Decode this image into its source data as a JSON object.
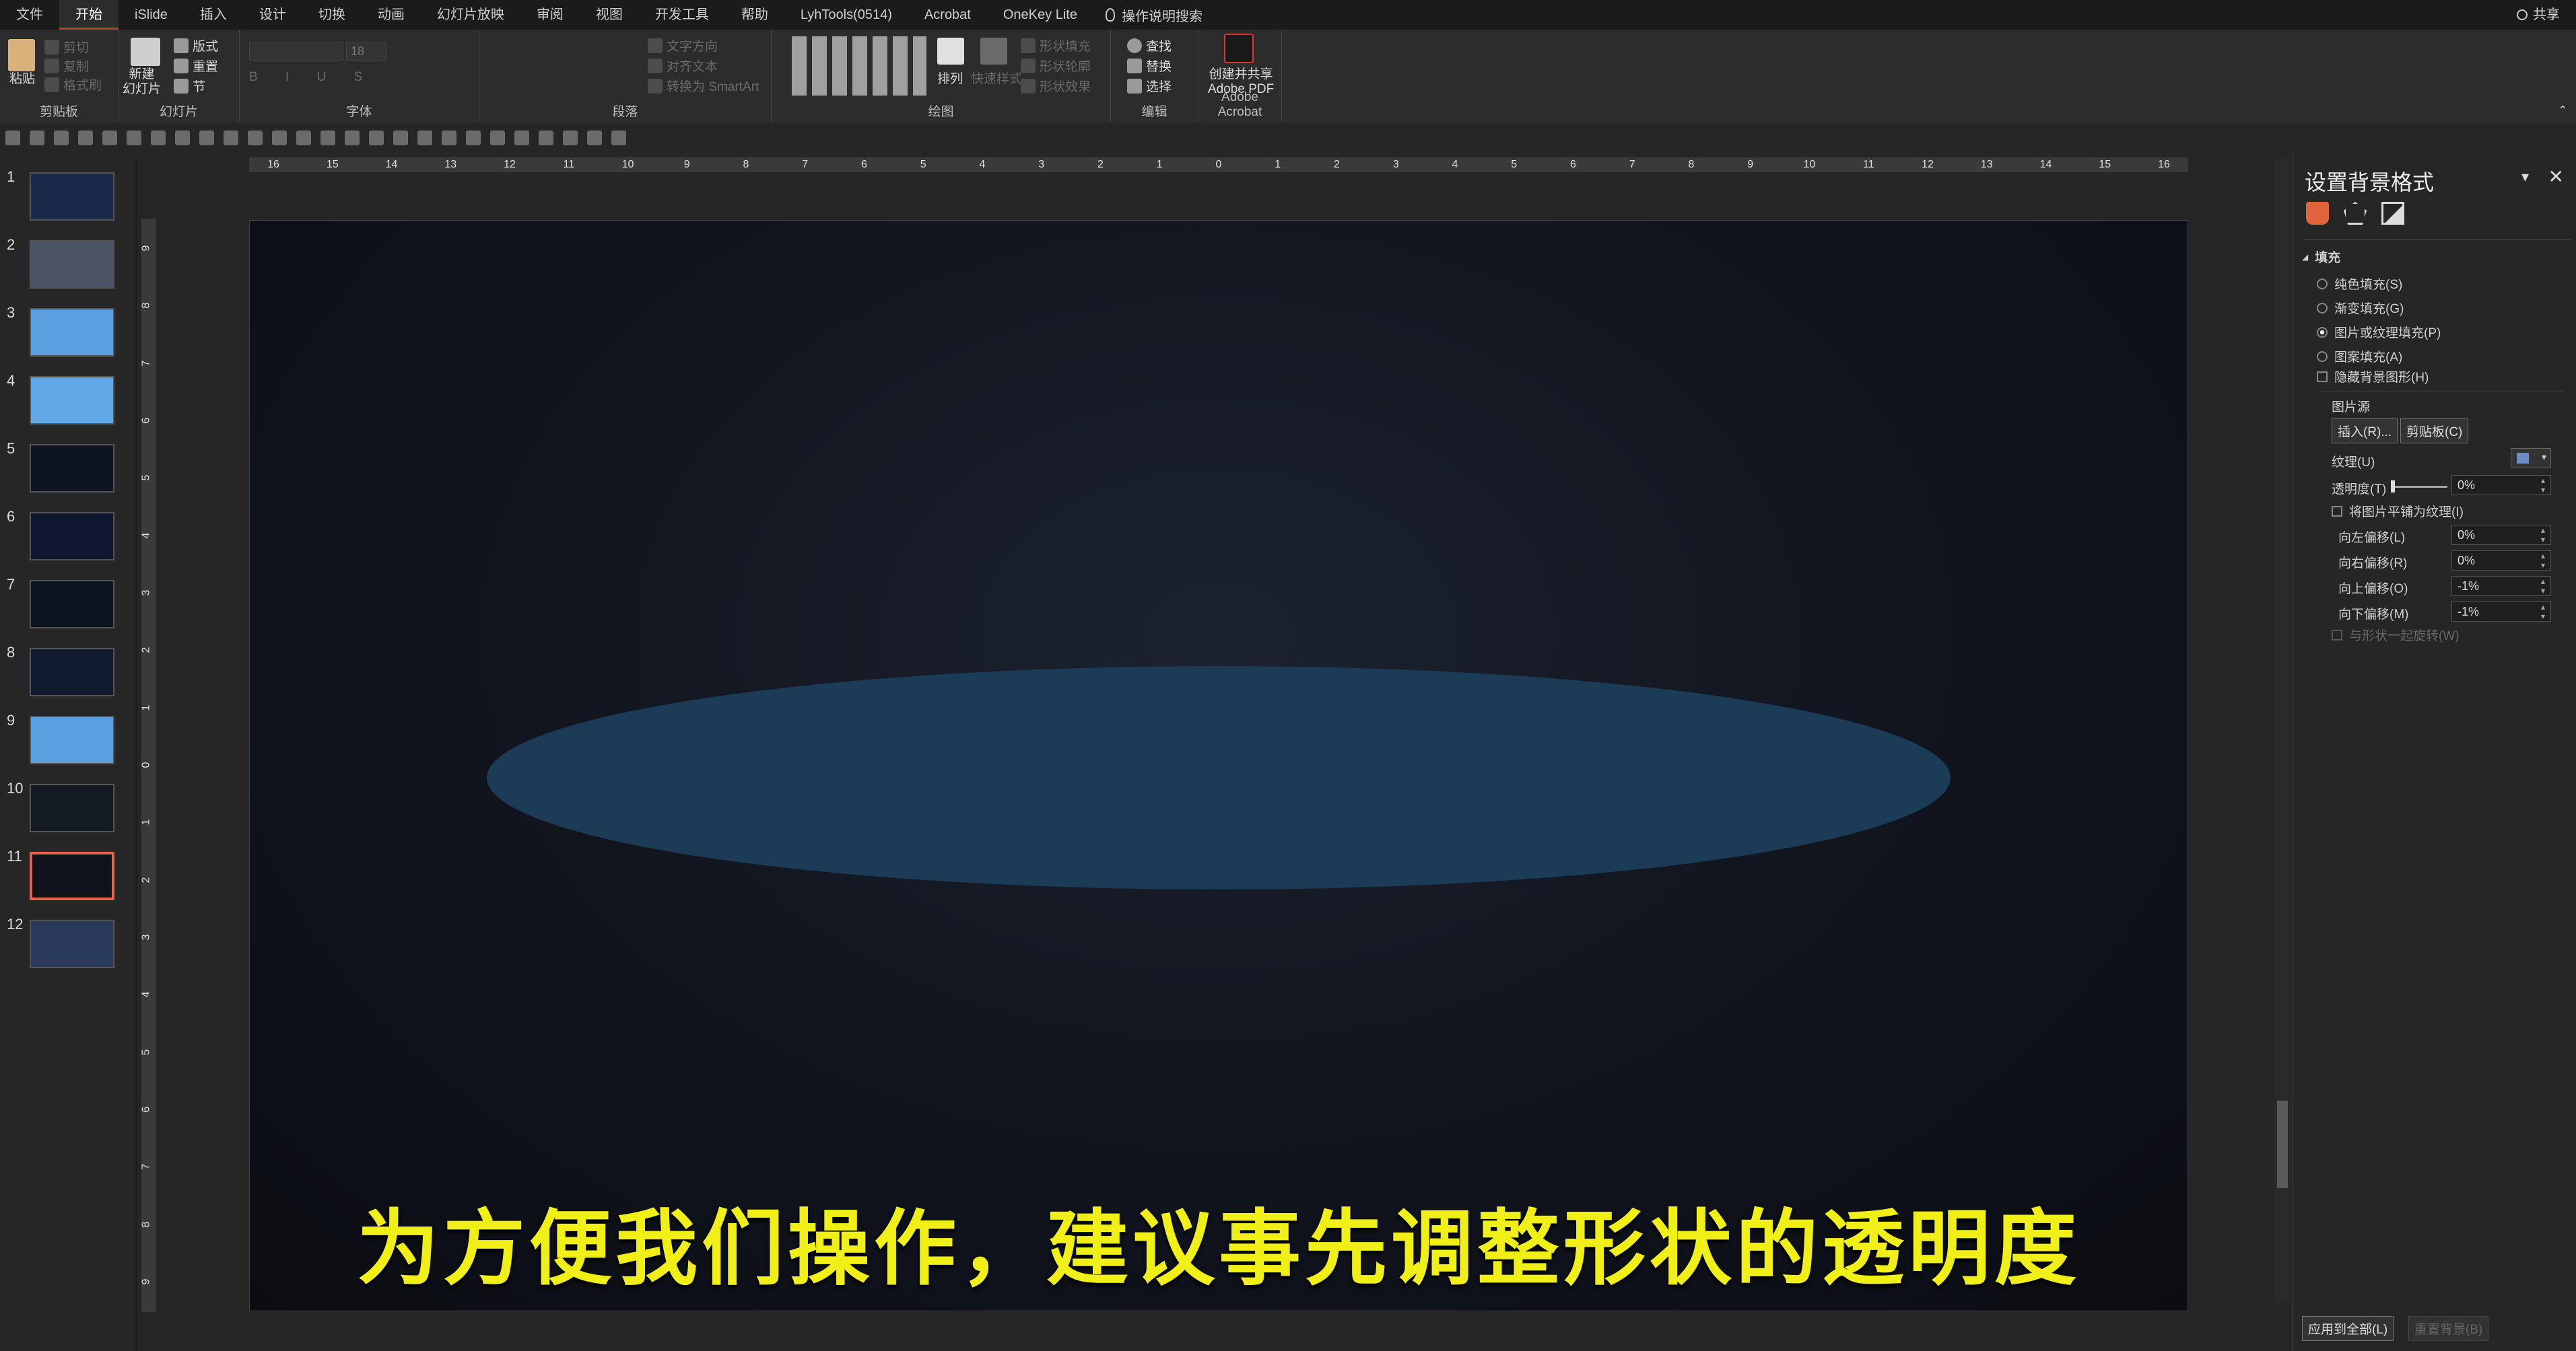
{
  "tabs": [
    "文件",
    "开始",
    "iSlide",
    "插入",
    "设计",
    "切换",
    "动画",
    "幻灯片放映",
    "审阅",
    "视图",
    "开发工具",
    "帮助",
    "LyhTools(0514)",
    "Acrobat",
    "OneKey Lite"
  ],
  "active_tab": "开始",
  "search_label": "操作说明搜索",
  "share_label": "共享",
  "ribbon": {
    "clipboard": {
      "paste": "粘贴",
      "cut": "剪切",
      "copy": "复制",
      "format_painter": "格式刷",
      "label": "剪贴板"
    },
    "slides": {
      "new_slide": "新建\n幻灯片",
      "layout": "版式",
      "reset": "重置",
      "section": "节",
      "label": "幻灯片"
    },
    "font": {
      "size": "18",
      "label": "字体"
    },
    "paragraph": {
      "text_dir": "文字方向",
      "align_text": "对齐文本",
      "smartart": "转换为 SmartArt",
      "label": "段落"
    },
    "drawing": {
      "arrange": "排列",
      "quick_styles": "快速样式",
      "shape_fill": "形状填充",
      "shape_outline": "形状轮廓",
      "shape_effects": "形状效果",
      "label": "绘图"
    },
    "editing": {
      "find": "查找",
      "replace": "替换",
      "select": "选择",
      "label": "编辑"
    },
    "acrobat": {
      "create": "创建并共享\nAdobe PDF",
      "label": "Adobe Acrobat"
    }
  },
  "hruler_ticks": [
    "16",
    "15",
    "14",
    "13",
    "12",
    "11",
    "10",
    "9",
    "8",
    "7",
    "6",
    "5",
    "4",
    "3",
    "2",
    "1",
    "0",
    "1",
    "2",
    "3",
    "4",
    "5",
    "6",
    "7",
    "8",
    "9",
    "10",
    "11",
    "12",
    "13",
    "14",
    "15",
    "16"
  ],
  "vruler_ticks": [
    "9",
    "8",
    "7",
    "6",
    "5",
    "4",
    "3",
    "2",
    "1",
    "0",
    "1",
    "2",
    "3",
    "4",
    "5",
    "6",
    "7",
    "8",
    "9"
  ],
  "thumbnails": [
    {
      "num": "1",
      "bg": "#1b2a4a"
    },
    {
      "num": "2",
      "bg": "#4a5466"
    },
    {
      "num": "3",
      "bg": "#5aa0e0"
    },
    {
      "num": "4",
      "bg": "#62a8e6"
    },
    {
      "num": "5",
      "bg": "#0e1422"
    },
    {
      "num": "6",
      "bg": "#0f1830"
    },
    {
      "num": "7",
      "bg": "#0e1422"
    },
    {
      "num": "8",
      "bg": "#121c30"
    },
    {
      "num": "9",
      "bg": "#5aa0e0"
    },
    {
      "num": "10",
      "bg": "#141a24"
    },
    {
      "num": "11",
      "bg": "#10131a"
    },
    {
      "num": "12",
      "bg": "#2a3a5a"
    }
  ],
  "selected_slide": "11",
  "caption": "为方便我们操作，建议事先调整形状的透明度",
  "ellipse_color": "#1b3b56",
  "pane": {
    "title": "设置背景格式",
    "section": "填充",
    "options": [
      {
        "label": "纯色填充(S)",
        "checked": false
      },
      {
        "label": "渐变填充(G)",
        "checked": false
      },
      {
        "label": "图片或纹理填充(P)",
        "checked": true
      },
      {
        "label": "图案填充(A)",
        "checked": false
      }
    ],
    "hide_bg": "隐藏背景图形(H)",
    "picture_source": "图片源",
    "insert_btn": "插入(R)...",
    "clipboard_btn": "剪贴板(C)",
    "texture_label": "纹理(U)",
    "transparency_label": "透明度(T)",
    "transparency_value": "0%",
    "tile_label": "将图片平铺为纹理(I)",
    "offsets": [
      {
        "label": "向左偏移(L)",
        "value": "0%"
      },
      {
        "label": "向右偏移(R)",
        "value": "0%"
      },
      {
        "label": "向上偏移(O)",
        "value": "-1%"
      },
      {
        "label": "向下偏移(M)",
        "value": "-1%"
      }
    ],
    "rotate_label": "与形状一起旋转(W)",
    "apply_all": "应用到全部(L)",
    "reset_bg": "重置背景(B)"
  }
}
